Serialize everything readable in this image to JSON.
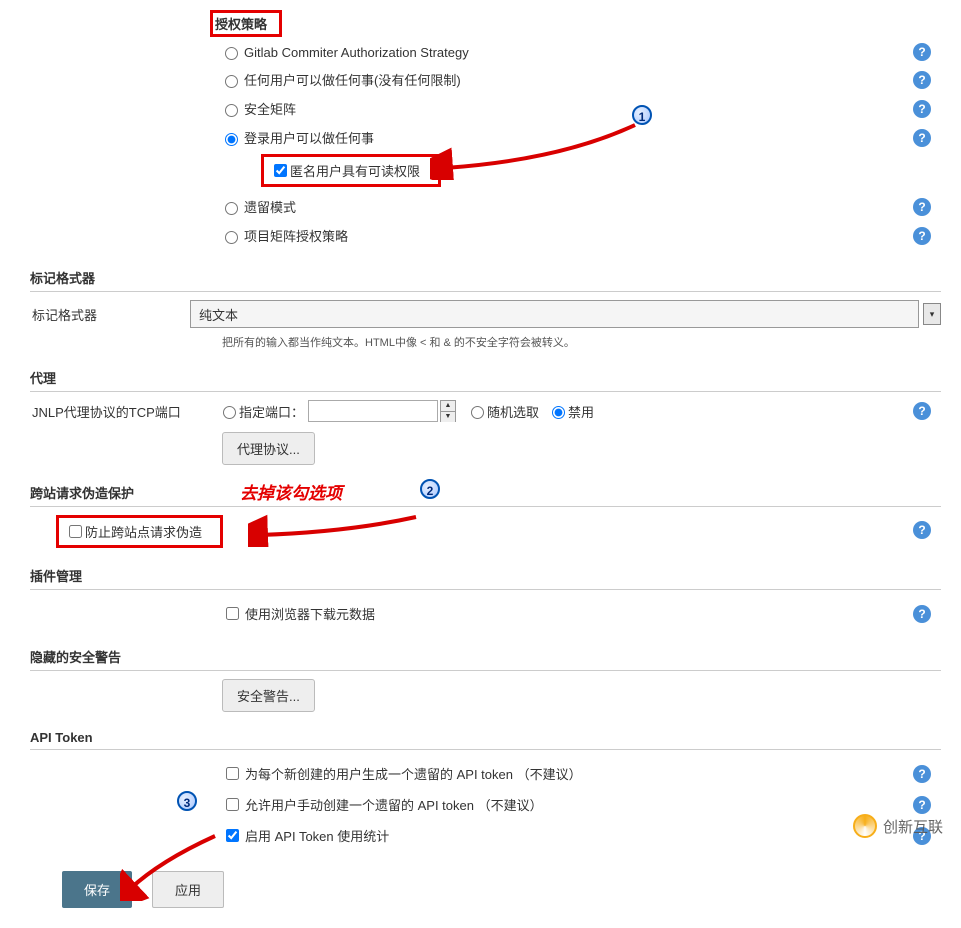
{
  "authStrategy": {
    "title": "授权策略",
    "options": {
      "gitlab": "Gitlab Commiter Authorization Strategy",
      "anyone": "任何用户可以做任何事(没有任何限制)",
      "matrix": "安全矩阵",
      "loggedIn": "登录用户可以做任何事",
      "anonymousRead": "匿名用户具有可读权限",
      "legacy": "遗留模式",
      "projectMatrix": "项目矩阵授权策略"
    }
  },
  "markup": {
    "sectionTitle": "标记格式器",
    "label": "标记格式器",
    "selected": "纯文本",
    "helper": "把所有的输入都当作纯文本。HTML中像 < 和 & 的不安全字符会被转义。"
  },
  "agents": {
    "title": "代理",
    "jnlpLabel": "JNLP代理协议的TCP端口",
    "portFixed": "指定端口：",
    "portRandom": "随机选取",
    "portDisabled": "禁用",
    "protocolsBtn": "代理协议..."
  },
  "csrf": {
    "title": "跨站请求伪造保护",
    "note": "去掉该勾选项",
    "option": "防止跨站点请求伪造"
  },
  "plugin": {
    "title": "插件管理",
    "browserDownload": "使用浏览器下载元数据"
  },
  "hiddenWarnings": {
    "title": "隐藏的安全警告",
    "btn": "安全警告..."
  },
  "apiToken": {
    "title": "API Token",
    "opt1": "为每个新创建的用户生成一个遗留的 API token  （不建议）",
    "opt2": "允许用户手动创建一个遗留的 API token  （不建议）",
    "opt3": "启用 API Token 使用统计"
  },
  "buttons": {
    "save": "保存",
    "apply": "应用"
  },
  "annotations": {
    "n1": "1",
    "n2": "2",
    "n3": "3"
  },
  "branding": "创新互联"
}
